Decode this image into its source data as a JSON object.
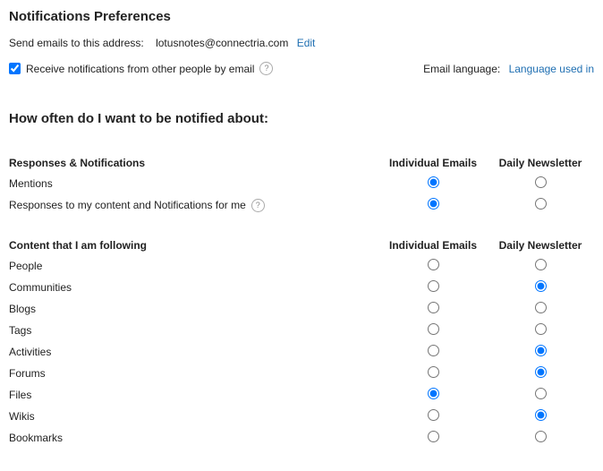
{
  "page_title": "Notifications Preferences",
  "email_line": {
    "label": "Send emails to this address:",
    "address": "lotusnotes@connectria.com",
    "edit_label": "Edit"
  },
  "receive": {
    "checked": true,
    "label": "Receive notifications from other people by email"
  },
  "language": {
    "label": "Email language:",
    "link": "Language used in"
  },
  "section_title": "How often do I want to be notified about:",
  "columns": {
    "individual": "Individual Emails",
    "daily": "Daily Newsletter"
  },
  "group1": {
    "header": "Responses & Notifications",
    "rows": [
      {
        "label": "Mentions",
        "help": false,
        "selected": "individual"
      },
      {
        "label": "Responses to my content and Notifications for me",
        "help": true,
        "selected": "individual"
      }
    ]
  },
  "group2": {
    "header": "Content that I am following",
    "rows": [
      {
        "label": "People",
        "selected": "none"
      },
      {
        "label": "Communities",
        "selected": "daily"
      },
      {
        "label": "Blogs",
        "selected": "none"
      },
      {
        "label": "Tags",
        "selected": "none"
      },
      {
        "label": "Activities",
        "selected": "daily"
      },
      {
        "label": "Forums",
        "selected": "daily"
      },
      {
        "label": "Files",
        "selected": "individual"
      },
      {
        "label": "Wikis",
        "selected": "daily"
      },
      {
        "label": "Bookmarks",
        "selected": "none"
      }
    ]
  }
}
